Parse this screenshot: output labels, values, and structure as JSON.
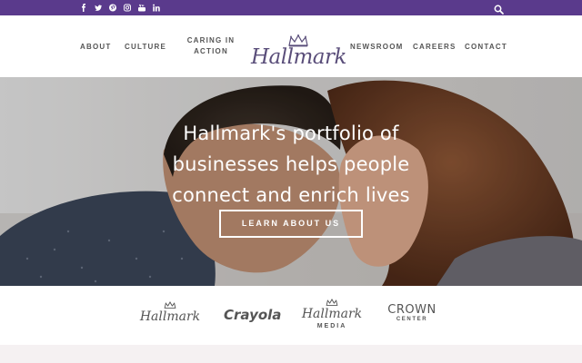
{
  "topbar": {
    "bg_color": "#5a3a8c",
    "social_icons": [
      "facebook-icon",
      "twitter-icon",
      "pinterest-icon",
      "instagram-icon",
      "youtube-icon",
      "linkedin-icon"
    ],
    "search_icon": "search-icon"
  },
  "nav": {
    "about": "ABOUT",
    "culture": "CULTURE",
    "caring_line1": "CARING IN",
    "caring_line2": "ACTION",
    "logo_text": "Hallmark",
    "newsroom": "NEWSROOM",
    "careers": "CAREERS",
    "contact": "CONTACT"
  },
  "hero": {
    "line1": "Hallmark's portfolio of",
    "line2": "businesses helps people",
    "line3": "connect and enrich lives",
    "cta_label": "LEARN ABOUT US"
  },
  "brands": {
    "hallmark": "Hallmark",
    "crayola": "Crayola",
    "hallmark_media_name": "Hallmark",
    "hallmark_media_sub": "MEDIA",
    "crown_center_name": "CROWN",
    "crown_center_sub": "CENTER"
  }
}
